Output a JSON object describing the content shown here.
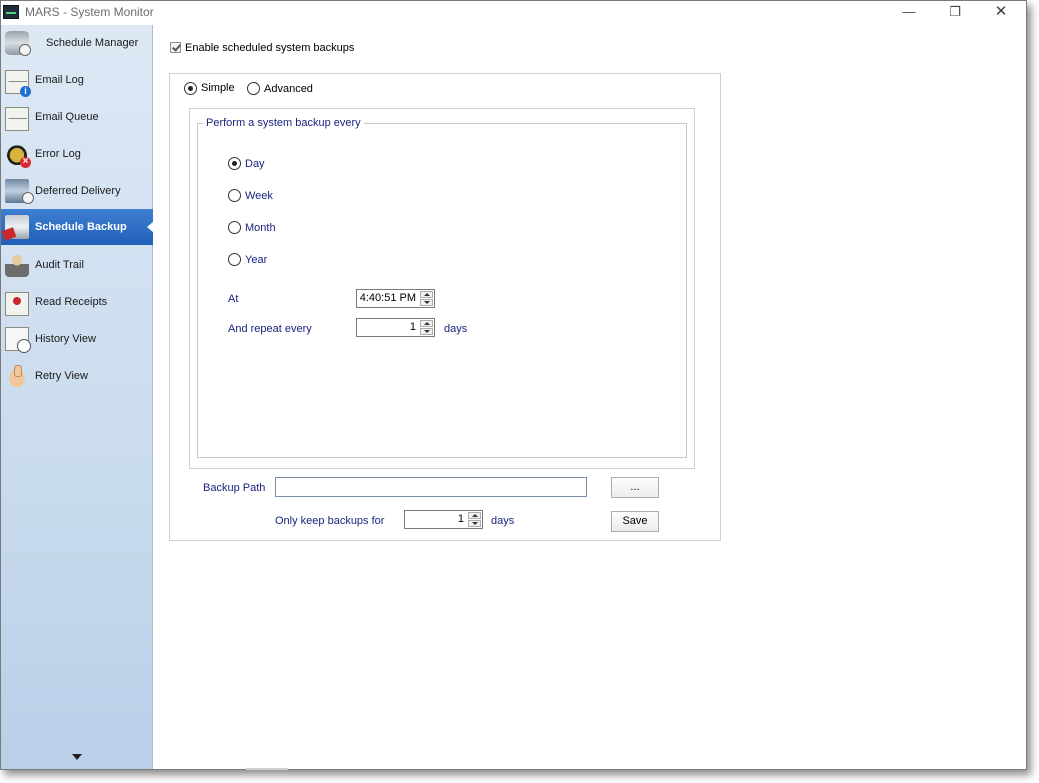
{
  "window": {
    "title": "MARS - System Monitor",
    "controls": {
      "minimize": "—",
      "maximize": "❐",
      "close": "✕"
    }
  },
  "sidebar": {
    "items": [
      {
        "label": "Schedule Manager",
        "icon": "database-clock-icon"
      },
      {
        "label": "Email Log",
        "icon": "email-info-icon"
      },
      {
        "label": "Email Queue",
        "icon": "envelope-icon"
      },
      {
        "label": "Error Log",
        "icon": "bug-error-icon"
      },
      {
        "label": "Deferred Delivery",
        "icon": "server-clock-icon"
      },
      {
        "label": "Schedule Backup",
        "icon": "backup-icon",
        "active": true
      },
      {
        "label": "Audit Trail",
        "icon": "audit-person-icon"
      },
      {
        "label": "Read Receipts",
        "icon": "read-receipt-icon"
      },
      {
        "label": "History View",
        "icon": "history-icon"
      },
      {
        "label": "Retry View",
        "icon": "thumbs-up-icon"
      }
    ]
  },
  "main": {
    "enable_label": "Enable scheduled system backups",
    "enable_checked": true,
    "mode": {
      "simple": "Simple",
      "advanced": "Advanced",
      "selected": "simple"
    },
    "group_title": "Perform a system backup every",
    "frequency": {
      "options": [
        "Day",
        "Week",
        "Month",
        "Year"
      ],
      "selected": "Day"
    },
    "at_label": "At",
    "at_value": "4:40:51 PM",
    "repeat_label": "And repeat every",
    "repeat_value": "1",
    "repeat_unit": "days",
    "backup_path_label": "Backup Path",
    "backup_path_value": "",
    "browse_label": "...",
    "keep_label": "Only keep backups for",
    "keep_value": "1",
    "keep_unit": "days",
    "save_label": "Save"
  }
}
